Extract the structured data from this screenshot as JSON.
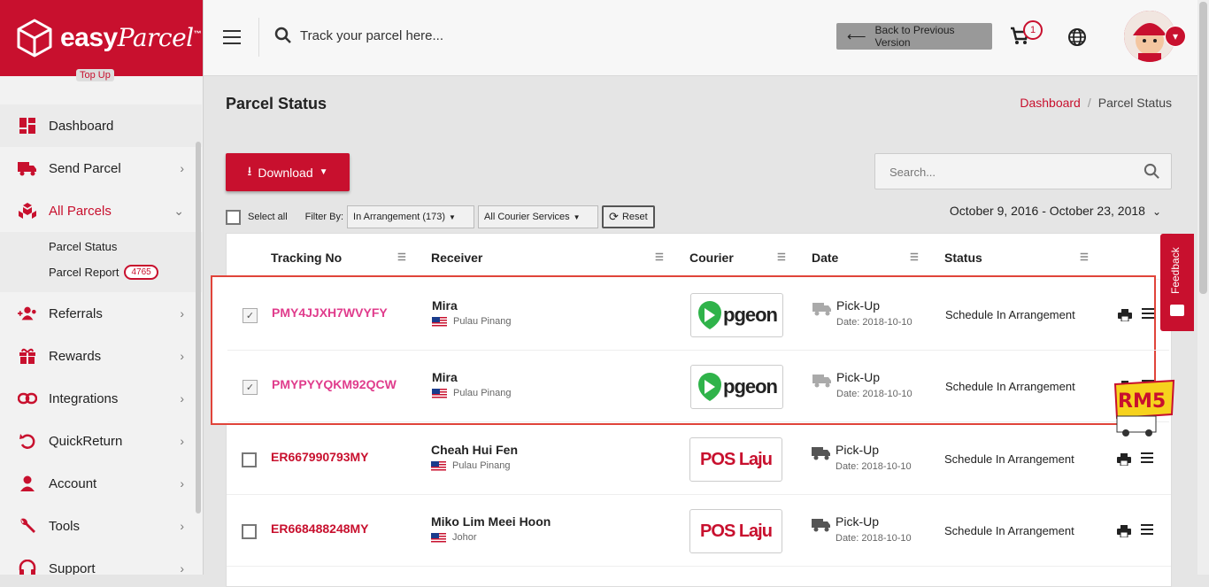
{
  "brand": {
    "name_bold": "easy",
    "name_script": "Parcel",
    "tm": "™",
    "topup": "Top Up"
  },
  "sidebar": {
    "items": [
      {
        "label": "Dashboard",
        "icon": "dashboard-icon",
        "chevron": false
      },
      {
        "label": "Send Parcel",
        "icon": "truck-icon",
        "chevron": true
      },
      {
        "label": "All Parcels",
        "icon": "boxes-icon",
        "chevron": true,
        "active": true
      },
      {
        "label": "Referrals",
        "icon": "referrals-icon",
        "chevron": true
      },
      {
        "label": "Rewards",
        "icon": "gift-icon",
        "chevron": true
      },
      {
        "label": "Integrations",
        "icon": "link-icon",
        "chevron": true
      },
      {
        "label": "QuickReturn",
        "icon": "return-icon",
        "chevron": true
      },
      {
        "label": "Account",
        "icon": "user-icon",
        "chevron": true
      },
      {
        "label": "Tools",
        "icon": "wrench-icon",
        "chevron": true
      },
      {
        "label": "Support",
        "icon": "headset-icon",
        "chevron": true
      }
    ],
    "sub": [
      {
        "label": "Parcel Status"
      },
      {
        "label": "Parcel Report",
        "badge": "4765"
      }
    ]
  },
  "topbar": {
    "search_placeholder": "Track your parcel here...",
    "back_label": "Back to Previous Version",
    "cart_count": "1"
  },
  "page": {
    "title": "Parcel Status",
    "crumb_home": "Dashboard",
    "crumb_sep": "/",
    "crumb_current": "Parcel Status"
  },
  "toolbar": {
    "download": "Download",
    "search_placeholder": "Search...",
    "select_all": "Select all",
    "filter_by": "Filter By:",
    "filter_status": "In Arrangement (173)",
    "filter_courier": "All Courier Services",
    "reset": "Reset",
    "date_range": "October 9, 2016 - October 23, 2018"
  },
  "table": {
    "headers": [
      "Tracking No",
      "Receiver",
      "Courier",
      "Date",
      "Status"
    ],
    "rows": [
      {
        "tracking": "PMY4JJXH7WVYFY",
        "receiver": "Mira",
        "location": "Pulau Pinang",
        "courier": "pgeon",
        "date_label": "Pick-Up",
        "date": "Date: 2018-10-10",
        "status": "Schedule In Arrangement",
        "checked": true
      },
      {
        "tracking": "PMYPYYQKM92QCW",
        "receiver": "Mira",
        "location": "Pulau Pinang",
        "courier": "pgeon",
        "date_label": "Pick-Up",
        "date": "Date: 2018-10-10",
        "status": "Schedule In Arrangement",
        "checked": true
      },
      {
        "tracking": "ER667990793MY",
        "receiver": "Cheah Hui Fen",
        "location": "Pulau Pinang",
        "courier": "POS Laju",
        "date_label": "Pick-Up",
        "date": "Date: 2018-10-10",
        "status": "Schedule In Arrangement",
        "checked": false
      },
      {
        "tracking": "ER668488248MY",
        "receiver": "Miko Lim Meei Hoon",
        "location": "Johor",
        "courier": "POS Laju",
        "date_label": "Pick-Up",
        "date": "Date: 2018-10-10",
        "status": "Schedule In Arrangement",
        "checked": false
      }
    ]
  },
  "feedback": {
    "label": "Feedback"
  },
  "promo": {
    "label": "RM5"
  },
  "colors": {
    "brand": "#c8102e",
    "highlight": "#e0443a",
    "pink": "#e03c8c"
  }
}
